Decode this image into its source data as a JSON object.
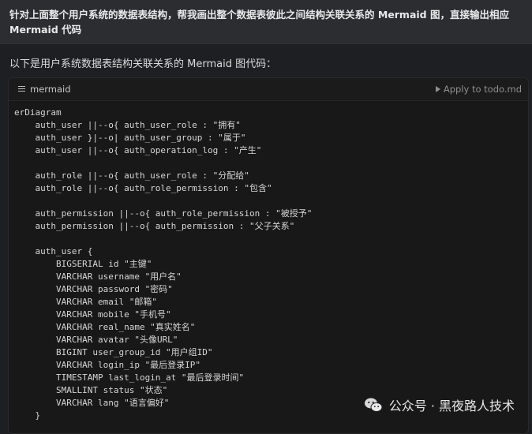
{
  "user_message": "针对上面整个用户系统的数据表结构，帮我画出整个数据表彼此之间结构关联关系的 Mermaid 图，直接输出相应 Mermaid 代码",
  "answer_intro": "以下是用户系统数据表结构关联关系的 Mermaid 图代码：",
  "code_block": {
    "language": "mermaid",
    "language_icon": "lines-icon",
    "apply_label": "Apply to todo.md",
    "apply_icon": "play-icon",
    "lines": [
      "erDiagram",
      "    auth_user ||--o{ auth_user_role : \"拥有\"",
      "    auth_user }|--o| auth_user_group : \"属于\"",
      "    auth_user ||--o{ auth_operation_log : \"产生\"",
      "",
      "    auth_role ||--o{ auth_user_role : \"分配给\"",
      "    auth_role ||--o{ auth_role_permission : \"包含\"",
      "",
      "    auth_permission ||--o{ auth_role_permission : \"被授予\"",
      "    auth_permission ||--o{ auth_permission : \"父子关系\"",
      "",
      "    auth_user {",
      "        BIGSERIAL id \"主键\"",
      "        VARCHAR username \"用户名\"",
      "        VARCHAR password \"密码\"",
      "        VARCHAR email \"邮箱\"",
      "        VARCHAR mobile \"手机号\"",
      "        VARCHAR real_name \"真实姓名\"",
      "        VARCHAR avatar \"头像URL\"",
      "        BIGINT user_group_id \"用户组ID\"",
      "        VARCHAR login_ip \"最后登录IP\"",
      "        TIMESTAMP last_login_at \"最后登录时间\"",
      "        SMALLINT status \"状态\"",
      "        VARCHAR lang \"语言偏好\"",
      "    }"
    ]
  },
  "watermark": {
    "text": "公众号 · 黑夜路人技术",
    "icon": "wechat-icon"
  }
}
